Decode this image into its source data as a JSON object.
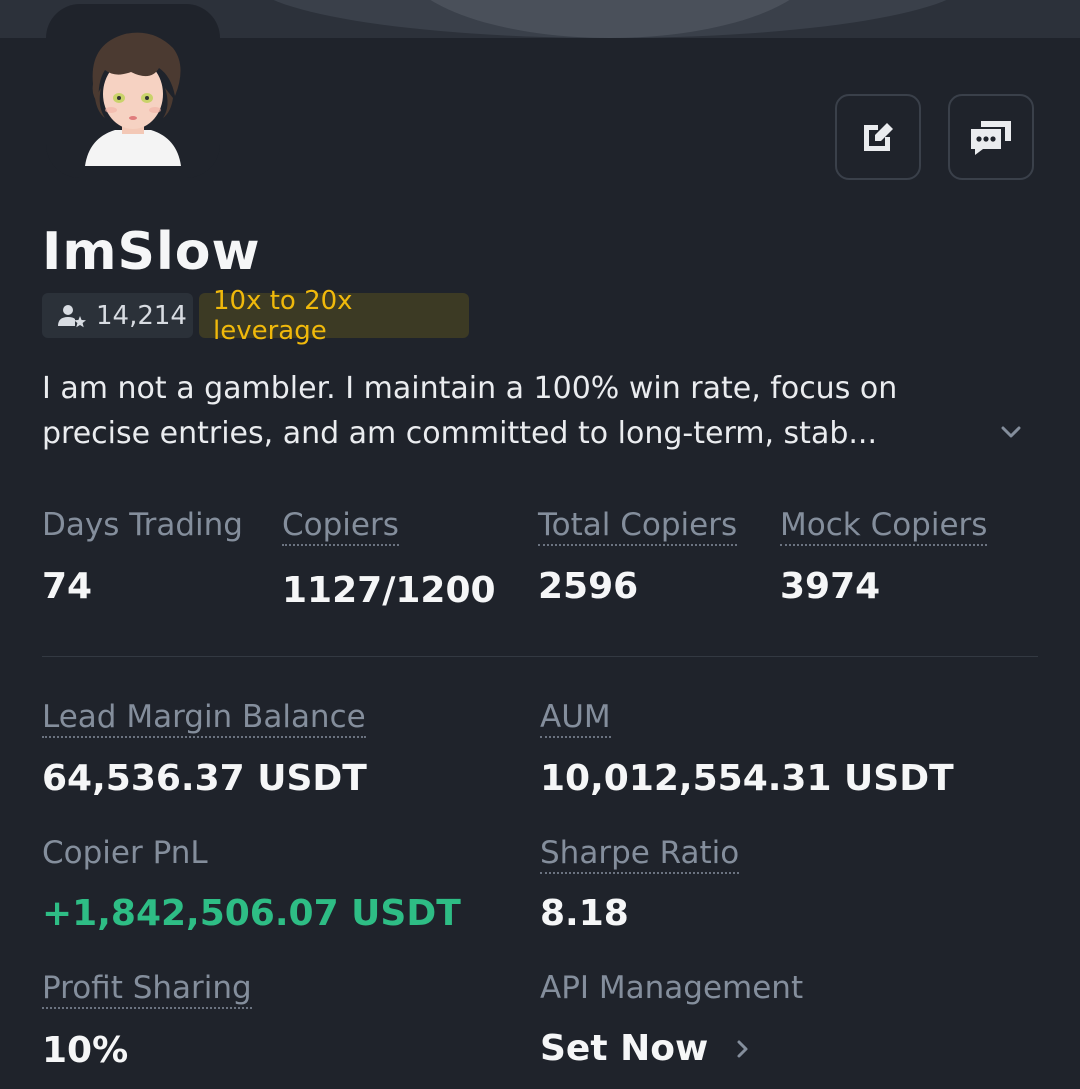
{
  "profile": {
    "name": "ImSlow",
    "followers": "14,214",
    "leverage_tag": "10x to 20x leverage",
    "bio_line1": "I am not a gambler. I maintain a 100% win rate, focus on",
    "bio_line2": "precise entries, and am committed to long-term, stab..."
  },
  "stats": {
    "days_trading": {
      "label": "Days Trading",
      "value": "74"
    },
    "copiers": {
      "label": "Copiers",
      "value": "1127/1200"
    },
    "total_copiers": {
      "label": "Total Copiers",
      "value": "2596"
    },
    "mock_copiers": {
      "label": "Mock Copiers",
      "value": "3974"
    }
  },
  "details": {
    "lead_margin_balance": {
      "label": "Lead Margin Balance",
      "value": "64,536.37 USDT"
    },
    "aum": {
      "label": "AUM",
      "value": "10,012,554.31 USDT"
    },
    "copier_pnl": {
      "label": "Copier PnL",
      "value": "+1,842,506.07 USDT"
    },
    "sharpe_ratio": {
      "label": "Sharpe Ratio",
      "value": "8.18"
    },
    "profit_sharing": {
      "label": "Profit Sharing",
      "value": "10%"
    },
    "api_management": {
      "label": "API Management",
      "value": "Set Now"
    }
  },
  "icons": {
    "edit": "edit-icon",
    "chat": "chat-icon",
    "followers": "user-star-icon",
    "expand": "chevron-down-icon",
    "arrow": "chevron-right-icon"
  },
  "colors": {
    "background": "#1f232b",
    "accent_yellow": "#f0b90b",
    "positive_green": "#2ebd85",
    "label_gray": "#848e9c"
  }
}
